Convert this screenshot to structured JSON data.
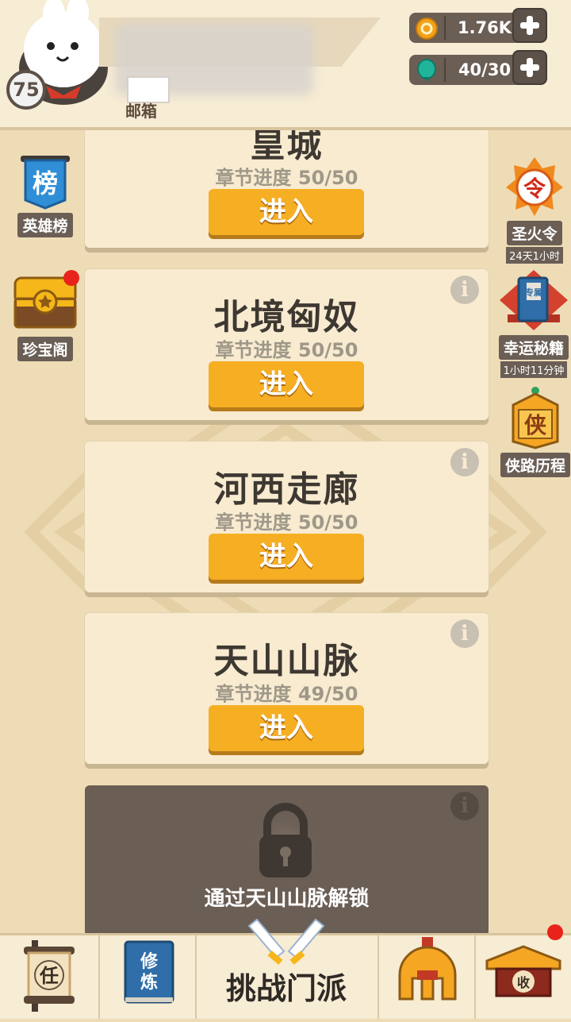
{
  "header": {
    "level": "75",
    "mail_label": "邮箱",
    "coins": {
      "icon": "coin-icon",
      "value": "1.76K"
    },
    "stamina": {
      "icon": "green-gem-icon",
      "value": "40/30"
    }
  },
  "left_side": [
    {
      "icon": "ranking-banner-icon",
      "label": "英雄榜"
    },
    {
      "icon": "treasure-chest-icon",
      "label": "珍宝阁"
    }
  ],
  "right_side": [
    {
      "icon": "holy-fire-token-icon",
      "label": "圣火令",
      "sub": "24天1小时"
    },
    {
      "icon": "secret-book-icon",
      "label": "幸运秘籍",
      "sub": "1小时11分钟"
    },
    {
      "icon": "hero-path-icon",
      "label": "侠路历程"
    }
  ],
  "chapters": [
    {
      "title": "皇城",
      "progress": "章节进度 50/50",
      "button": "进入"
    },
    {
      "title": "北境匈奴",
      "progress": "章节进度 50/50",
      "button": "进入"
    },
    {
      "title": "河西走廊",
      "progress": "章节进度 50/50",
      "button": "进入"
    },
    {
      "title": "天山山脉",
      "progress": "章节进度 49/50",
      "button": "进入"
    }
  ],
  "locked": {
    "unlock_text": "通过天山山脉解锁"
  },
  "info_glyph": "i",
  "bottom_nav": {
    "task_glyph": "任",
    "cultivate_glyph_1": "修",
    "cultivate_glyph_2": "炼",
    "main_label": "挑战门派",
    "shop_glyph": "收"
  },
  "colors": {
    "accent_orange": "#f6ae23",
    "card_bg": "#f8ebd0",
    "dark_panel": "#6a5e55",
    "notification_red": "#e8231b"
  }
}
